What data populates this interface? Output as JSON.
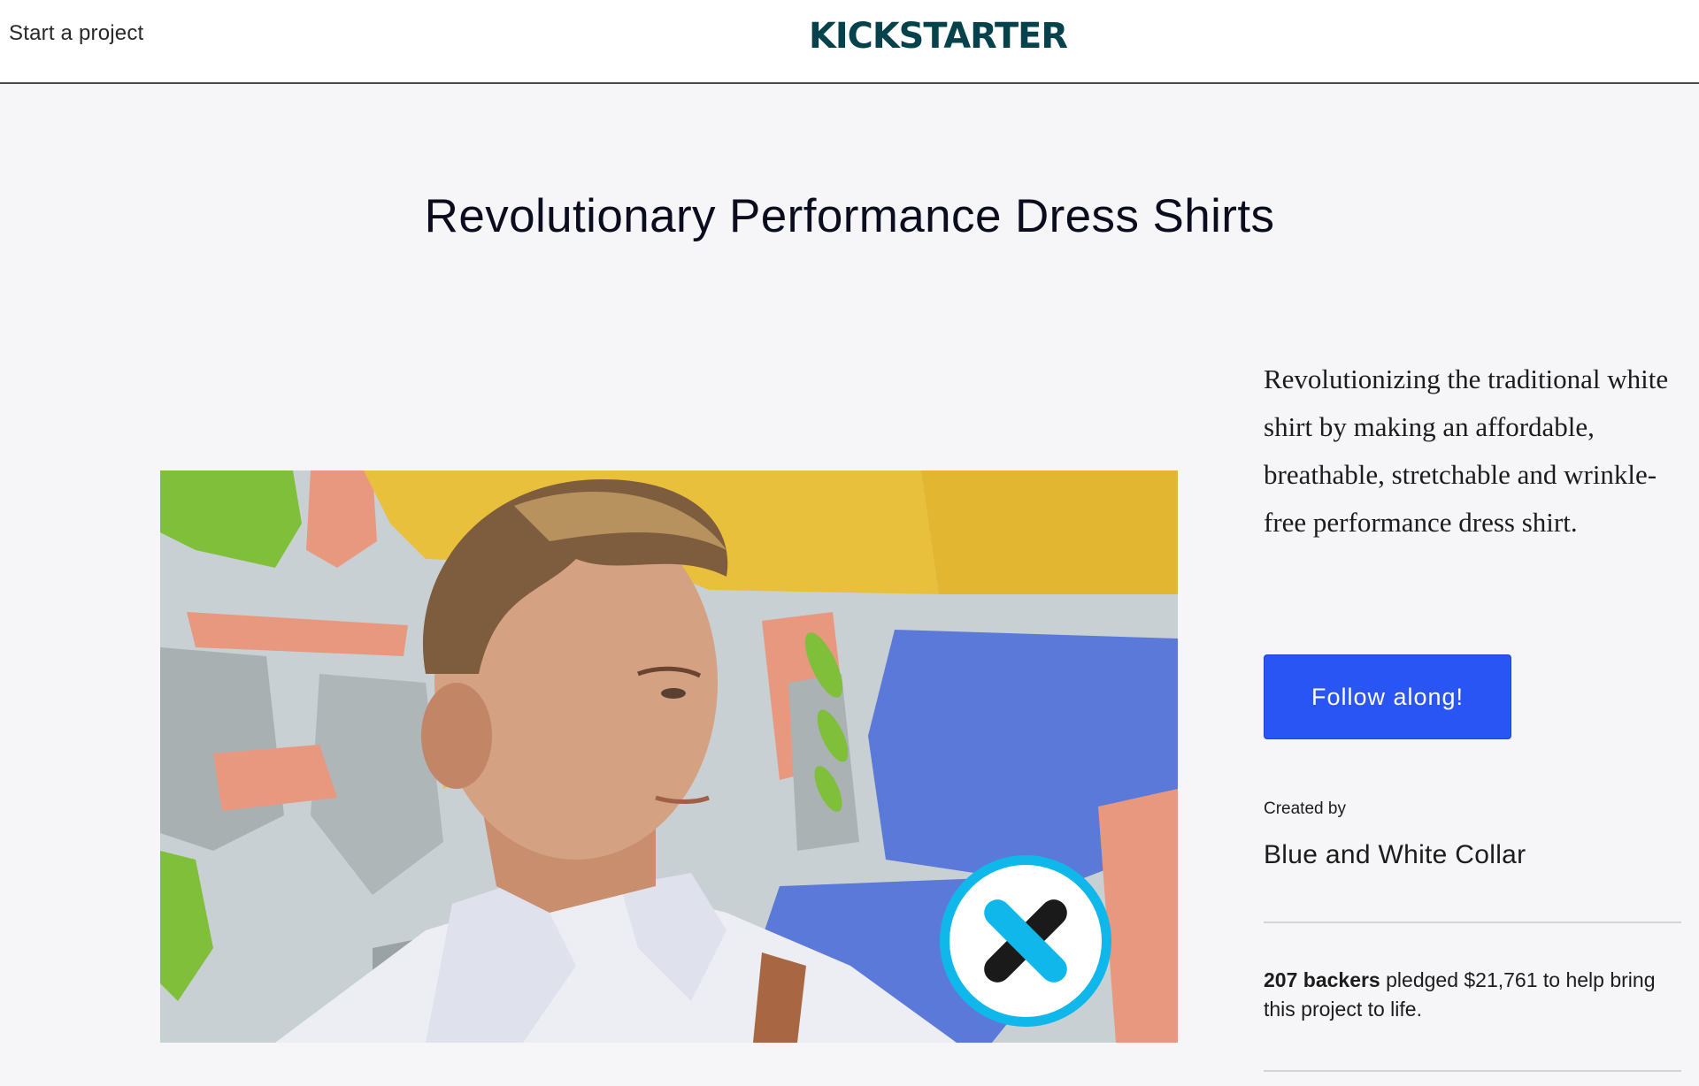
{
  "header": {
    "start_project": "Start a project",
    "logo_text": "KICKSTARTER",
    "logo_color": "#05424b"
  },
  "project": {
    "title": "Revolutionary Performance Dress Shirts",
    "blurb": "Revolutionizing the traditional white shirt by making an affordable, breathable, stretchable and wrinkle-free performance dress shirt.",
    "follow_button": "Follow along!",
    "created_by_label": "Created by",
    "creator": "Blue and White Collar",
    "backers": "207 backers",
    "pledge_text": " pledged $21,761 to help bring this project to life."
  },
  "colors": {
    "page_bg": "#f6f6f8",
    "button": "#2a55f5",
    "brand_badge": "#10b7ea"
  }
}
